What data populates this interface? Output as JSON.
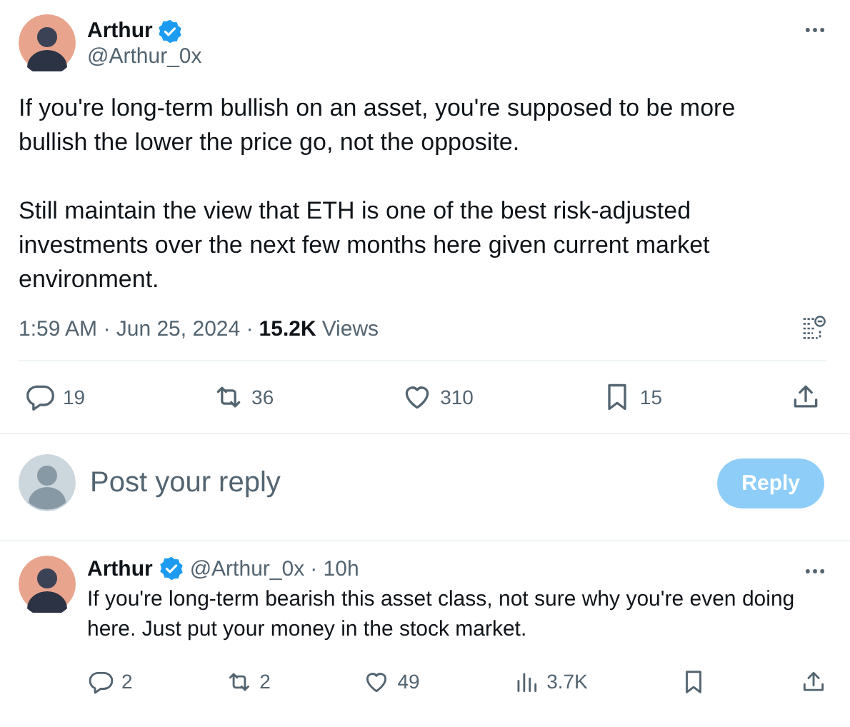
{
  "tweet": {
    "author": {
      "name": "Arthur",
      "handle": "@Arthur_0x",
      "verified": true
    },
    "paragraphs": [
      "If you're long-term bullish on an asset, you're supposed to be more bullish the lower the price go, not the opposite.",
      "Still maintain the view that ETH is one of the best risk-adjusted investments over the next few months here given current market environment."
    ],
    "time": "1:59 AM",
    "separator": "·",
    "date": "Jun 25, 2024",
    "views": "15.2K",
    "views_label": "Views",
    "actions": [
      {
        "kind": "reply",
        "count": "19"
      },
      {
        "kind": "repost",
        "count": "36"
      },
      {
        "kind": "like",
        "count": "310"
      },
      {
        "kind": "bookmark",
        "count": "15"
      },
      {
        "kind": "share"
      }
    ]
  },
  "composer": {
    "placeholder": "Post your reply",
    "button": {
      "label": "Reply",
      "disabled": true
    }
  },
  "replies": [
    {
      "author": {
        "name": "Arthur",
        "handle": "@Arthur_0x",
        "verified": true
      },
      "separator": "·",
      "age": "10h",
      "text": "If you're long-term bearish this asset class, not sure why you're even doing here. Just put your money in the stock market.",
      "actions": [
        {
          "kind": "reply",
          "count": "2"
        },
        {
          "kind": "repost",
          "count": "2"
        },
        {
          "kind": "like",
          "count": "49"
        },
        {
          "kind": "views",
          "count": "3.7K"
        },
        {
          "kind": "bookmark"
        },
        {
          "kind": "share"
        }
      ]
    }
  ]
}
